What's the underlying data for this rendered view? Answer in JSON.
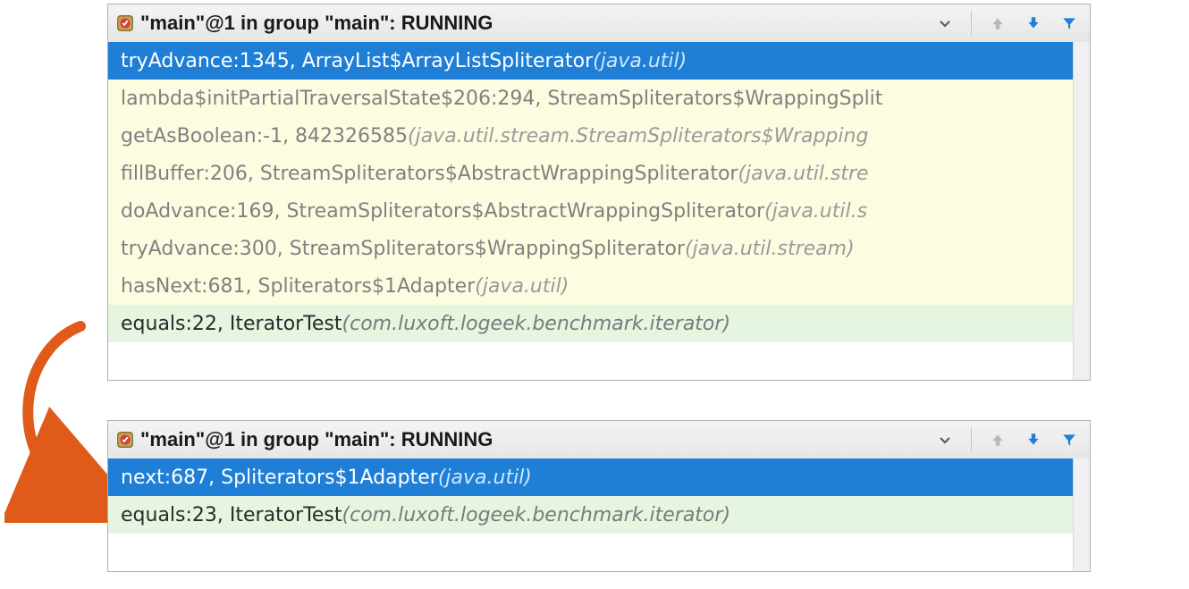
{
  "panel1": {
    "title": "\"main\"@1 in group \"main\": RUNNING",
    "frames": [
      {
        "kind": "selected",
        "text": "tryAdvance:1345, ArrayList$ArrayListSpliterator ",
        "loc": "(java.util)"
      },
      {
        "kind": "lib",
        "text": "lambda$initPartialTraversalState$206:294, StreamSpliterators$WrappingSplit",
        "loc": ""
      },
      {
        "kind": "lib",
        "text": "getAsBoolean:-1, 842326585 ",
        "loc": "(java.util.stream.StreamSpliterators$Wrapping"
      },
      {
        "kind": "lib",
        "text": "fillBuffer:206, StreamSpliterators$AbstractWrappingSpliterator ",
        "loc": "(java.util.stre"
      },
      {
        "kind": "lib",
        "text": "doAdvance:169, StreamSpliterators$AbstractWrappingSpliterator ",
        "loc": "(java.util.s"
      },
      {
        "kind": "lib",
        "text": "tryAdvance:300, StreamSpliterators$WrappingSpliterator ",
        "loc": "(java.util.stream)"
      },
      {
        "kind": "lib",
        "text": "hasNext:681, Spliterators$1Adapter ",
        "loc": "(java.util)"
      },
      {
        "kind": "user",
        "text": "equals:22, IteratorTest ",
        "loc": "(com.luxoft.logeek.benchmark.iterator)"
      }
    ]
  },
  "panel2": {
    "title": "\"main\"@1 in group \"main\": RUNNING",
    "frames": [
      {
        "kind": "selected",
        "text": "next:687, Spliterators$1Adapter ",
        "loc": "(java.util)"
      },
      {
        "kind": "user",
        "text": "equals:23, IteratorTest ",
        "loc": "(com.luxoft.logeek.benchmark.iterator)"
      }
    ]
  }
}
